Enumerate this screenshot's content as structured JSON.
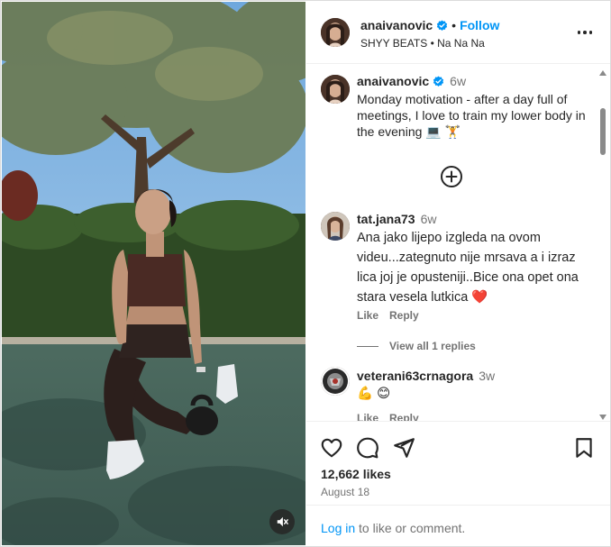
{
  "post": {
    "username": "anaivanovic",
    "separator": "•",
    "follow_label": "Follow",
    "audio": "SHYY BEATS • Na Na Na",
    "more_icon": "more-options-icon"
  },
  "caption": {
    "username": "anaivanovic",
    "time": "6w",
    "text": "Monday motivation - after a day full of meetings, I love to train my lower body in the evening 💻 🏋️"
  },
  "comments": [
    {
      "username": "tat.jana73",
      "time": "6w",
      "text": "Ana jako lijepo izgleda na ovom videu...zategnuto nije mrsava a i izraz lica joj je opusteniji..Bice ona opet ona stara vesela lutkica ❤️",
      "like_label": "Like",
      "reply_label": "Reply",
      "view_replies": "View all 1 replies"
    },
    {
      "username": "veterani63crnagora",
      "time": "3w",
      "text": "💪 😊",
      "like_label": "Like",
      "reply_label": "Reply"
    }
  ],
  "stats": {
    "likes": "12,662 likes",
    "date": "August 18"
  },
  "login": {
    "link_label": "Log in",
    "rest": " to like or comment."
  },
  "colors": {
    "accent": "#0095f6",
    "heart": "#ff3040",
    "muted": "#737373"
  }
}
